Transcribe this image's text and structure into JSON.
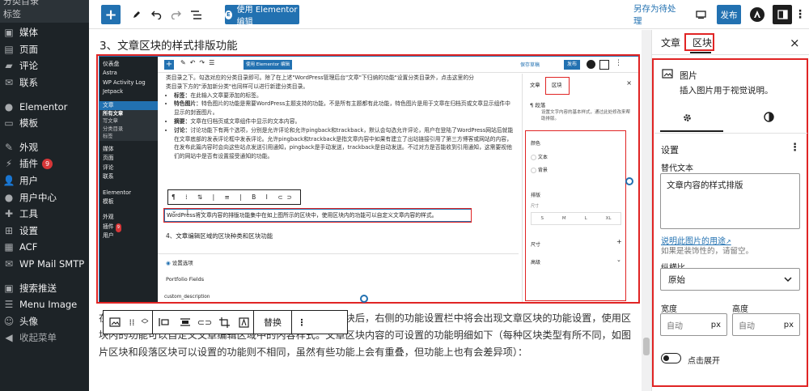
{
  "admin_menu": {
    "top_sub": [
      "分类目录",
      "标签"
    ],
    "items": [
      {
        "label": "媒体",
        "icon": "media-icon"
      },
      {
        "label": "页面",
        "icon": "page-icon"
      },
      {
        "label": "评论",
        "icon": "comment-icon"
      },
      {
        "label": "联系",
        "icon": "mail-icon"
      },
      {
        "label": "Elementor",
        "icon": "elementor-icon"
      },
      {
        "label": "模板",
        "icon": "folder-icon"
      },
      {
        "label": "外观",
        "icon": "brush-icon"
      },
      {
        "label": "插件",
        "icon": "plugin-icon",
        "badge": "9"
      },
      {
        "label": "用户",
        "icon": "user-icon"
      },
      {
        "label": "用户中心",
        "icon": "user-center-icon"
      },
      {
        "label": "工具",
        "icon": "wrench-icon"
      },
      {
        "label": "设置",
        "icon": "settings-icon"
      },
      {
        "label": "ACF",
        "icon": "acf-icon"
      },
      {
        "label": "WP Mail SMTP",
        "icon": "smtp-icon"
      },
      {
        "label": "搜索推送",
        "icon": "push-icon"
      },
      {
        "label": "Menu Image",
        "icon": "menu-image-icon"
      },
      {
        "label": "头像",
        "icon": "avatar-icon"
      },
      {
        "label": "收起菜单",
        "icon": "collapse-icon"
      }
    ]
  },
  "header": {
    "elementor_label": "使用 Elementor 编辑",
    "save_draft_label": "另存为待处理",
    "publish_label": "发布"
  },
  "content": {
    "heading": "3、文章区块的样式排版功能",
    "paragraph": "在如上图所示的区块中，在选中了文章内容编辑区域的区块后，右侧的功能设置栏中将会出现文章区块的功能设置，使用区块内的功能可以自定义文章编辑区域中的内容样式。文章区块内容的可设置的功能明细如下（每种区块类型有所不同，如图片区块和段落区块可以设置的功能则不相同，虽然有些功能上会有重叠，但功能上也有会差异项）：",
    "toolbar_replace": "替换"
  },
  "inner_shot": {
    "menu": [
      "仪表盘",
      "Astra",
      "WP Activity Log",
      "Jetpack",
      "文章",
      "媒体",
      "页面",
      "评论",
      "联系",
      "Elementor",
      "模板",
      "外观",
      "插件",
      "用户"
    ],
    "menu_sub": [
      "所有文章",
      "写文章",
      "分类目录",
      "标签"
    ],
    "plugin_badge": "9",
    "elementor_label": "使用 Elementor 编辑",
    "save_draft": "保存草稿",
    "publish": "发布",
    "body_lines": [
      "类目录之下。勾选对应的分类目录即可。除了在上述\"WordPress管理后台\"文章\"下归纳的功能\"设置分类目录外，点击这里的分",
      "类目录下方的\"添加新分类\"也同样可以进行新建分类目录。"
    ],
    "bullets": [
      {
        "k": "标签：",
        "v": "在此输入文章要添加的标签。"
      },
      {
        "k": "特色图片：",
        "v": "特色图片的功能是需要WordPress主题支持的功能，不是所有主题都有此功能，特色图片是用于文章在归档页或文章显示组件中显示的封面图片。"
      },
      {
        "k": "摘要：",
        "v": "文章在归档页或文章组件中显示的文本内容。"
      },
      {
        "k": "讨论：",
        "v": "讨论功能下有两个选项，分别是允许评论和允许pingback和trackback，默认会勾选允许评论，用户在登陆了WordPress网站后就能在文章底部的发表评论框中发表评论。允许pingback和trackback是指文章内容中如果有建立了出站链接引用了第三方博客或网站的内容，在发布此篇内容时会向这些站点发送引用通知，pingback是手动发送，trackback是自动发送。不过对方是否能收到引用通知，这需要视他们的网站中是否有设置接受通知的功能。"
      }
    ],
    "selected_para": "WordPress将文章内容的排版功能集中在如上图所示的区块中，使用区块内的功能可以自定义文章内容的样式。",
    "section4": "4、文章编辑区域的区块种类和区块功能",
    "settings_title": "设置选项",
    "portfolio": "Portfolio Fields",
    "custom_desc": "custom_description",
    "panel_tabs": [
      "文章",
      "区块"
    ],
    "panel_para_title": "段落",
    "panel_para_desc": "设置文字内容的基本样式，通过此处修改来帮助排版。",
    "panel_color": "颜色",
    "panel_text": "文本",
    "panel_bg": "背景",
    "panel_typo": "排版",
    "panel_size": "尺寸",
    "panel_sizes": [
      "S",
      "M",
      "L",
      "XL"
    ],
    "panel_dimension": "尺寸",
    "panel_advanced": "高级"
  },
  "settings": {
    "tab_post": "文章",
    "tab_block": "区块",
    "block_name": "图片",
    "block_desc": "插入图片用于视觉说明。",
    "section_title": "设置",
    "alt_label": "替代文本",
    "alt_value": "文章内容的样式排版",
    "alt_help_link": "说明此图片的用途",
    "alt_help_text": "如果是装饰性的，请留空。",
    "aspect_label": "纵横比",
    "aspect_value": "原始",
    "width_label": "宽度",
    "height_label": "高度",
    "width_placeholder": "自动",
    "height_placeholder": "自动",
    "unit": "px",
    "expand_label": "点击展开"
  }
}
